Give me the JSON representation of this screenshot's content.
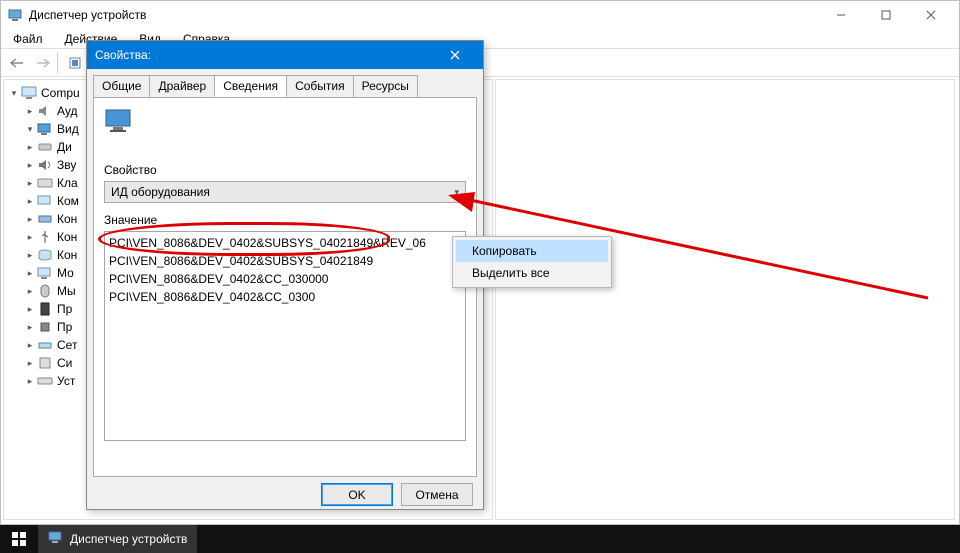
{
  "dm": {
    "title": "Диспетчер устройств",
    "menu": {
      "file": "Файл",
      "action": "Действие",
      "view": "Вид",
      "help": "Справка"
    },
    "tree": {
      "root": "Compu",
      "items": [
        {
          "label": "Ауд"
        },
        {
          "label": "Вид"
        },
        {
          "label": "Ди"
        },
        {
          "label": "Зву"
        },
        {
          "label": "Кла"
        },
        {
          "label": "Ком"
        },
        {
          "label": "Кон"
        },
        {
          "label": "Кон"
        },
        {
          "label": "Кон"
        },
        {
          "label": "Мо"
        },
        {
          "label": "Мы"
        },
        {
          "label": "Пр"
        },
        {
          "label": "Пр"
        },
        {
          "label": "Сет"
        },
        {
          "label": "Си"
        },
        {
          "label": "Уст"
        }
      ]
    }
  },
  "dialog": {
    "title": "Свойства:",
    "tabs": {
      "general": "Общие",
      "driver": "Драйвер",
      "details": "Сведения",
      "events": "События",
      "resources": "Ресурсы"
    },
    "property_label": "Свойство",
    "property_value": "ИД оборудования",
    "value_label": "Значение",
    "values": [
      "PCI\\VEN_8086&DEV_0402&SUBSYS_04021849&REV_06",
      "PCI\\VEN_8086&DEV_0402&SUBSYS_04021849",
      "PCI\\VEN_8086&DEV_0402&CC_030000",
      "PCI\\VEN_8086&DEV_0402&CC_0300"
    ],
    "ok": "OK",
    "cancel": "Отмена"
  },
  "context": {
    "copy": "Копировать",
    "select_all": "Выделить все"
  },
  "taskbar": {
    "app": "Диспетчер устройств"
  }
}
